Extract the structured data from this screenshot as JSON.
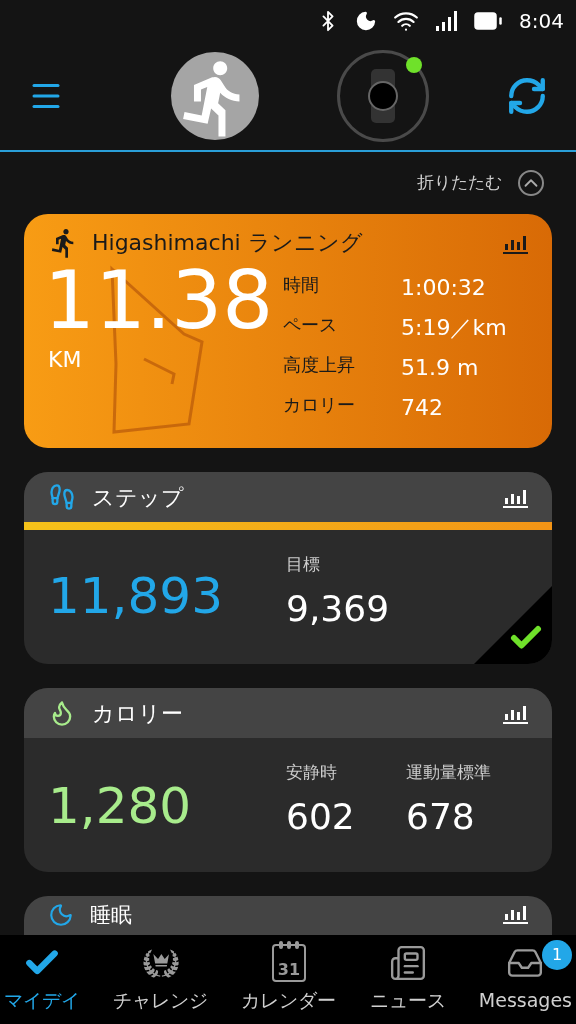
{
  "status_bar": {
    "time": "8:04"
  },
  "header": {
    "device_connected": true
  },
  "collapse": {
    "label": "折りたたむ"
  },
  "activity": {
    "title": "Higashimachi ランニング",
    "distance": "11.38",
    "unit": "KM",
    "stats": [
      {
        "label": "時間",
        "value": "1:00:32"
      },
      {
        "label": "ペース",
        "value": "5:19／km"
      },
      {
        "label": "高度上昇",
        "value": "51.9 m"
      },
      {
        "label": "カロリー",
        "value": "742"
      }
    ]
  },
  "steps": {
    "title": "ステップ",
    "level": 1,
    "value": "11,893",
    "goal_label": "目標",
    "goal": "9,369",
    "goal_met": true
  },
  "calories": {
    "title": "カロリー",
    "value": "1,280",
    "stats": [
      {
        "label": "安静時",
        "value": "602"
      },
      {
        "label": "運動量標準",
        "value": "678"
      }
    ]
  },
  "sleep": {
    "title": "睡眠"
  },
  "nav": [
    {
      "kind": "myday",
      "label": "マイデイ",
      "selected": true
    },
    {
      "kind": "challenge",
      "label": "チャレンジ",
      "selected": false
    },
    {
      "kind": "calendar",
      "label": "カレンダー",
      "selected": false,
      "icon_text": "31"
    },
    {
      "kind": "news",
      "label": "ニュース",
      "selected": false
    },
    {
      "kind": "messages",
      "label": "Messages",
      "selected": false,
      "badge": "1"
    }
  ]
}
